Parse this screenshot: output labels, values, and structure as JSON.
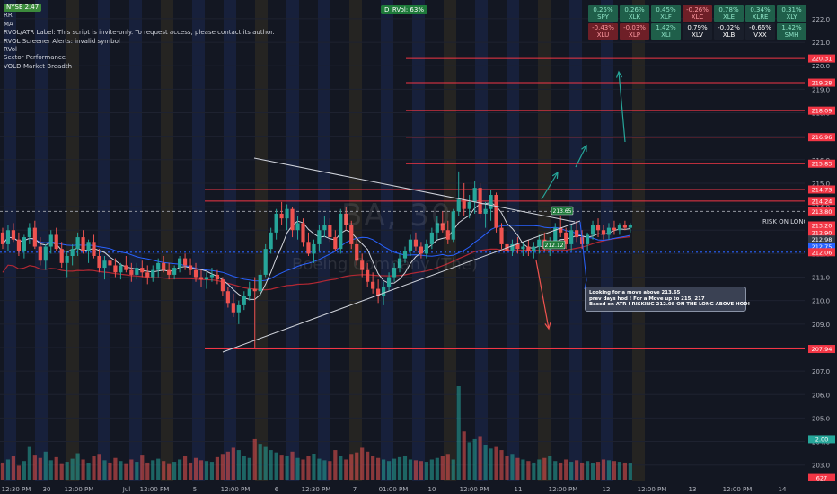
{
  "indicators": {
    "items": [
      "MA",
      "RVOL/ATR Label: This script is invite-only. To request access, please contact its author.",
      "RVOL Screener Alerts: invalid symbol",
      "RVol",
      "Sector Performance",
      "VOLD-Market Breadth"
    ],
    "first": "NYSE 2.47",
    "second": "RR"
  },
  "breadth_badge": "D_RVol: 63%",
  "watermark": {
    "symbol": "BA, 30",
    "name": "Boeing Company (The)"
  },
  "sector_table": [
    {
      "pct": "0.25%",
      "ticker": "SPY",
      "tone": "pos"
    },
    {
      "pct": "0.26%",
      "ticker": "XLK",
      "tone": "pos"
    },
    {
      "pct": "0.45%",
      "ticker": "XLF",
      "tone": "pos"
    },
    {
      "pct": "-0.26%",
      "ticker": "XLC",
      "tone": "neg"
    },
    {
      "pct": "0.78%",
      "ticker": "XLE",
      "tone": "pos"
    },
    {
      "pct": "0.34%",
      "ticker": "XLRE",
      "tone": "pos"
    },
    {
      "pct": "0.31%",
      "ticker": "XLY",
      "tone": "pos"
    },
    {
      "pct": "-0.43%",
      "ticker": "XLU",
      "tone": "neg"
    },
    {
      "pct": "-0.03%",
      "ticker": "XLP",
      "tone": "neg"
    },
    {
      "pct": "1.42%",
      "ticker": "XLI",
      "tone": "pos"
    },
    {
      "pct": "0.79%",
      "ticker": "XLV",
      "tone": "neu"
    },
    {
      "pct": "-0.02%",
      "ticker": "XLB",
      "tone": "neu"
    },
    {
      "pct": "-0.66%",
      "ticker": "VXX",
      "tone": "neu"
    },
    {
      "pct": "1.42%",
      "ticker": "SMH",
      "tone": "pos"
    }
  ],
  "note": {
    "lines": [
      "Looking for a move above 213.65",
      "prev days hod ! For a Move up to 215, 217",
      "Based on ATR ! RISKING 212.08 ON THE LONG ABOVE HOD!"
    ]
  },
  "colors": {
    "background": "#131722",
    "up": "#26a69a",
    "down": "#ef5350",
    "level": "#f23645",
    "ma_fast": "#d1d4dc",
    "ma_slow": "#2962ff",
    "ma_long": "#b22833",
    "trend": "#d1d4dc",
    "target_arrow": "#26a69a"
  },
  "chart_data": {
    "type": "candlestick",
    "symbol": "BA",
    "timeframe": "30",
    "ylim": [
      202.3,
      222.8
    ],
    "y_ticks": [
      203,
      204,
      205,
      206,
      207,
      208,
      209,
      210,
      211,
      212,
      213,
      214,
      215,
      216,
      217,
      218,
      219,
      220,
      221,
      222
    ],
    "x_ticks": [
      "12:30 PM",
      "30",
      "12:00 PM",
      "Jul",
      "12:00 PM",
      "5",
      "12:00 PM",
      "6",
      "12:30 PM",
      "7",
      "01:00 PM",
      "10",
      "12:00 PM",
      "11",
      "12:00 PM",
      "12",
      "12:00 PM",
      "13",
      "12:00 PM",
      "14"
    ],
    "bars": 150,
    "candles": [
      [
        212.9,
        213.1,
        212.2,
        212.4
      ],
      [
        212.4,
        213.2,
        212.1,
        213.0
      ],
      [
        213.0,
        213.3,
        212.5,
        212.6
      ],
      [
        212.6,
        212.9,
        211.9,
        212.1
      ],
      [
        212.1,
        212.8,
        211.8,
        212.7
      ],
      [
        212.7,
        213.3,
        212.4,
        213.1
      ],
      [
        213.1,
        213.4,
        212.2,
        212.3
      ],
      [
        212.3,
        212.7,
        211.5,
        211.7
      ],
      [
        211.7,
        212.4,
        211.3,
        212.3
      ],
      [
        212.3,
        213.0,
        212.0,
        212.8
      ],
      [
        212.8,
        213.1,
        212.1,
        212.2
      ],
      [
        212.2,
        212.5,
        211.4,
        211.6
      ],
      [
        211.6,
        212.1,
        211.0,
        211.9
      ],
      [
        211.9,
        212.4,
        211.5,
        212.2
      ],
      [
        212.2,
        212.9,
        211.9,
        212.7
      ],
      [
        212.7,
        213.0,
        212.0,
        212.1
      ],
      [
        212.1,
        212.6,
        211.6,
        212.5
      ],
      [
        212.5,
        212.8,
        211.8,
        211.9
      ],
      [
        211.9,
        212.2,
        211.2,
        211.4
      ],
      [
        211.4,
        211.9,
        210.9,
        211.7
      ],
      [
        211.7,
        212.1,
        211.3,
        211.5
      ],
      [
        211.5,
        211.8,
        211.0,
        211.2
      ],
      [
        211.2,
        211.6,
        210.9,
        211.5
      ],
      [
        211.5,
        211.9,
        211.2,
        211.3
      ],
      [
        211.3,
        211.6,
        210.8,
        211.1
      ],
      [
        211.1,
        211.6,
        210.9,
        211.4
      ],
      [
        211.4,
        211.7,
        211.0,
        211.2
      ],
      [
        211.2,
        211.5,
        210.7,
        211.0
      ],
      [
        211.0,
        211.5,
        210.8,
        211.3
      ],
      [
        211.3,
        211.8,
        211.0,
        211.6
      ],
      [
        211.6,
        211.9,
        211.2,
        211.3
      ],
      [
        211.3,
        211.6,
        210.9,
        211.1
      ],
      [
        211.1,
        211.5,
        210.9,
        211.4
      ],
      [
        211.4,
        211.9,
        211.2,
        211.8
      ],
      [
        211.8,
        212.0,
        211.3,
        211.5
      ],
      [
        211.5,
        211.8,
        211.1,
        211.3
      ],
      [
        211.3,
        211.6,
        210.8,
        211.0
      ],
      [
        211.0,
        211.3,
        210.6,
        210.9
      ],
      [
        210.9,
        211.2,
        210.5,
        211.0
      ],
      [
        211.0,
        211.4,
        210.8,
        211.1
      ],
      [
        211.1,
        211.3,
        210.7,
        210.9
      ],
      [
        210.9,
        211.0,
        210.2,
        210.4
      ],
      [
        210.4,
        210.6,
        209.7,
        209.9
      ],
      [
        209.9,
        210.3,
        209.3,
        209.5
      ],
      [
        209.5,
        210.0,
        209.0,
        209.8
      ],
      [
        209.8,
        210.4,
        209.6,
        210.2
      ],
      [
        210.2,
        210.8,
        210.0,
        210.5
      ],
      [
        210.5,
        211.0,
        208.0,
        210.4
      ],
      [
        210.4,
        211.3,
        210.2,
        211.1
      ],
      [
        211.1,
        212.4,
        211.0,
        212.2
      ],
      [
        212.2,
        213.1,
        212.0,
        212.9
      ],
      [
        212.9,
        213.9,
        212.6,
        213.7
      ],
      [
        213.7,
        214.2,
        213.2,
        213.5
      ],
      [
        213.5,
        214.1,
        213.0,
        213.9
      ],
      [
        213.9,
        214.0,
        212.7,
        213.0
      ],
      [
        213.0,
        213.6,
        212.6,
        213.3
      ],
      [
        213.3,
        213.5,
        212.3,
        212.5
      ],
      [
        212.5,
        212.9,
        211.9,
        212.0
      ],
      [
        212.0,
        212.6,
        211.6,
        212.4
      ],
      [
        212.4,
        213.2,
        212.1,
        213.0
      ],
      [
        213.0,
        213.6,
        212.7,
        213.2
      ],
      [
        213.2,
        213.5,
        212.5,
        212.7
      ],
      [
        212.7,
        213.0,
        212.1,
        212.2
      ],
      [
        212.2,
        213.9,
        212.0,
        213.7
      ],
      [
        213.7,
        214.0,
        213.0,
        213.2
      ],
      [
        213.2,
        213.4,
        212.2,
        212.4
      ],
      [
        212.4,
        212.7,
        211.5,
        211.7
      ],
      [
        211.7,
        212.0,
        211.0,
        211.3
      ],
      [
        211.3,
        211.6,
        210.6,
        210.8
      ],
      [
        210.8,
        211.2,
        210.3,
        210.5
      ],
      [
        210.5,
        210.9,
        209.9,
        210.2
      ],
      [
        210.2,
        210.8,
        209.8,
        210.6
      ],
      [
        210.6,
        211.2,
        210.4,
        211.0
      ],
      [
        211.0,
        211.6,
        210.8,
        211.4
      ],
      [
        211.4,
        212.0,
        211.2,
        211.8
      ],
      [
        211.8,
        212.3,
        211.6,
        212.1
      ],
      [
        212.1,
        212.8,
        211.9,
        212.6
      ],
      [
        212.6,
        212.9,
        212.1,
        212.3
      ],
      [
        212.3,
        212.5,
        211.8,
        212.0
      ],
      [
        212.0,
        212.6,
        211.8,
        212.4
      ],
      [
        212.4,
        213.1,
        212.2,
        212.9
      ],
      [
        212.9,
        213.6,
        212.6,
        213.3
      ],
      [
        213.3,
        213.8,
        212.9,
        213.0
      ],
      [
        213.0,
        213.4,
        212.4,
        212.6
      ],
      [
        212.6,
        213.9,
        212.5,
        213.8
      ],
      [
        213.8,
        215.5,
        213.6,
        214.3
      ],
      [
        214.3,
        215.0,
        213.6,
        213.9
      ],
      [
        213.9,
        214.5,
        213.5,
        214.2
      ],
      [
        214.2,
        215.1,
        213.7,
        214.8
      ],
      [
        214.8,
        215.0,
        213.5,
        213.7
      ],
      [
        213.7,
        214.2,
        213.1,
        213.9
      ],
      [
        213.9,
        214.7,
        213.4,
        214.5
      ],
      [
        214.5,
        214.6,
        212.9,
        213.1
      ],
      [
        213.1,
        213.3,
        212.2,
        212.4
      ],
      [
        212.4,
        212.8,
        211.9,
        212.1
      ],
      [
        212.1,
        212.6,
        211.9,
        212.4
      ],
      [
        212.4,
        212.7,
        212.0,
        212.2
      ],
      [
        212.2,
        212.5,
        211.9,
        212.3
      ],
      [
        212.3,
        212.6,
        211.9,
        212.1
      ],
      [
        212.1,
        212.5,
        211.8,
        212.3
      ],
      [
        212.3,
        212.8,
        212.0,
        212.6
      ],
      [
        212.6,
        212.9,
        212.1,
        212.2
      ],
      [
        212.2,
        212.7,
        211.9,
        212.5
      ],
      [
        212.5,
        213.3,
        212.3,
        213.1
      ],
      [
        213.1,
        213.6,
        212.7,
        212.9
      ],
      [
        212.9,
        213.1,
        212.2,
        212.4
      ],
      [
        212.4,
        213.2,
        212.1,
        213.0
      ],
      [
        213.0,
        213.4,
        212.5,
        212.7
      ],
      [
        212.7,
        213.0,
        212.2,
        212.4
      ],
      [
        212.4,
        212.9,
        212.1,
        212.8
      ],
      [
        212.8,
        213.4,
        212.6,
        213.2
      ],
      [
        213.2,
        213.5,
        212.7,
        213.0
      ],
      [
        213.0,
        213.2,
        212.6,
        212.8
      ],
      [
        212.8,
        213.3,
        212.6,
        213.1
      ],
      [
        213.1,
        213.4,
        212.8,
        213.0
      ],
      [
        213.0,
        213.3,
        212.8,
        213.2
      ],
      [
        213.2,
        213.4,
        213.0,
        213.1
      ],
      [
        213.1,
        213.3,
        212.9,
        213.2
      ]
    ],
    "volume_max": 1200,
    "volumes": [
      220,
      260,
      300,
      180,
      240,
      420,
      310,
      280,
      360,
      250,
      290,
      200,
      230,
      270,
      340,
      260,
      210,
      300,
      320,
      250,
      220,
      280,
      240,
      200,
      260,
      230,
      310,
      220,
      250,
      270,
      240,
      200,
      230,
      260,
      300,
      220,
      280,
      250,
      240,
      230,
      290,
      320,
      360,
      410,
      380,
      300,
      280,
      520,
      460,
      420,
      380,
      350,
      310,
      300,
      360,
      280,
      260,
      300,
      330,
      270,
      250,
      240,
      380,
      300,
      260,
      320,
      350,
      410,
      360,
      300,
      280,
      260,
      240,
      270,
      290,
      300,
      260,
      250,
      240,
      230,
      260,
      280,
      300,
      320,
      260,
      1200,
      620,
      480,
      520,
      560,
      440,
      400,
      420,
      380,
      300,
      320,
      280,
      260,
      240,
      220,
      260,
      280,
      300,
      240,
      220,
      260,
      230,
      250,
      220,
      240,
      210,
      230,
      260,
      250,
      240,
      230,
      220,
      210,
      220,
      240
    ],
    "levels": [
      {
        "price": 220.31,
        "label": "220.31"
      },
      {
        "price": 219.28,
        "label": "219.28"
      },
      {
        "price": 218.09,
        "label": "218.09"
      },
      {
        "price": 216.96,
        "label": "216.96"
      },
      {
        "price": 215.83,
        "label": "215.83"
      },
      {
        "price": 214.73,
        "label": "214.73"
      },
      {
        "price": 214.24,
        "label": "214.24"
      },
      {
        "price": 207.94,
        "label": "207.94"
      }
    ],
    "price_labels": [
      {
        "price": 213.8,
        "label": "213.80",
        "kind": "current"
      },
      {
        "price": 213.2,
        "label": "213.20",
        "kind": "red"
      },
      {
        "price": 212.9,
        "label": "212.90",
        "kind": "red"
      },
      {
        "price": 212.6,
        "label": "212.98",
        "kind": "neutral"
      },
      {
        "price": 212.3,
        "label": "212.75",
        "kind": "blue"
      },
      {
        "price": 212.06,
        "label": "212.06",
        "kind": "red"
      },
      {
        "price": 202.45,
        "label": "627",
        "kind": "red"
      },
      {
        "price": 204.1,
        "label": "2.00",
        "kind": "green"
      }
    ],
    "risk_label": {
      "text": "RISK ON LONG",
      "price": 213.2
    },
    "entry_badges": [
      {
        "text": "213.65",
        "price": 213.65
      },
      {
        "text": "212.12",
        "price": 212.12
      }
    ],
    "current_price": 213.8,
    "stop_price": 212.06
  }
}
